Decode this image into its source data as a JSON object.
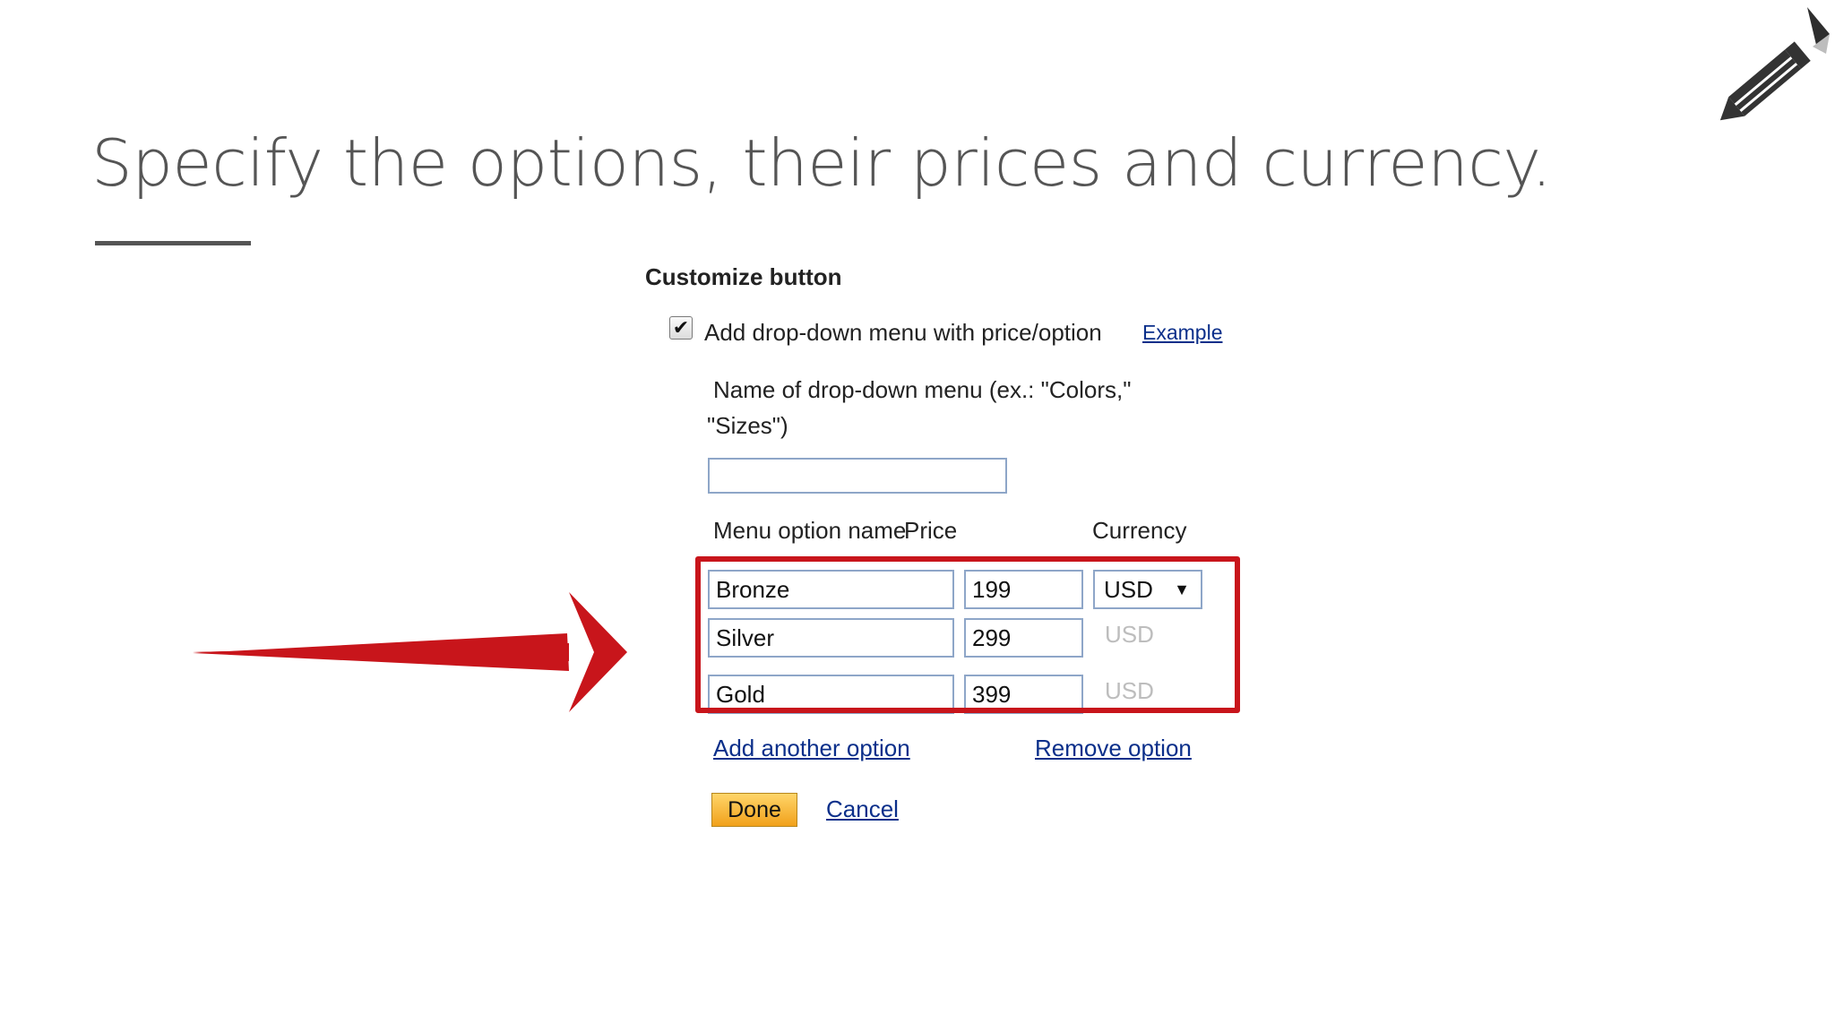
{
  "slide": {
    "title": "Specify the options, their prices and currency."
  },
  "form": {
    "section_title": "Customize button",
    "checkbox_checked": true,
    "checkbox_label": "Add drop-down menu with price/option",
    "example_link": "Example",
    "name_label_line1": "Name of drop-down menu (ex.: \"Colors,\"",
    "name_label_line2": "\"Sizes\")",
    "name_value": "",
    "headers": {
      "option_name": "Menu option name",
      "price": "Price",
      "currency": "Currency"
    },
    "options": [
      {
        "name": "Bronze",
        "price": "199",
        "currency": "USD"
      },
      {
        "name": "Silver",
        "price": "299",
        "currency": "USD"
      },
      {
        "name": "Gold",
        "price": "399",
        "currency": "USD"
      }
    ],
    "add_option_link": "Add another option",
    "remove_option_link": "Remove option",
    "done_button": "Done",
    "cancel_link": "Cancel"
  },
  "colors": {
    "highlight": "#c8151b",
    "link": "#0b2f8a",
    "done_button": "#f1a11b",
    "title_text": "#555555"
  },
  "icons": [
    "pencil-icon",
    "red-arrow-icon",
    "checkmark-icon",
    "dropdown-caret-icon"
  ]
}
